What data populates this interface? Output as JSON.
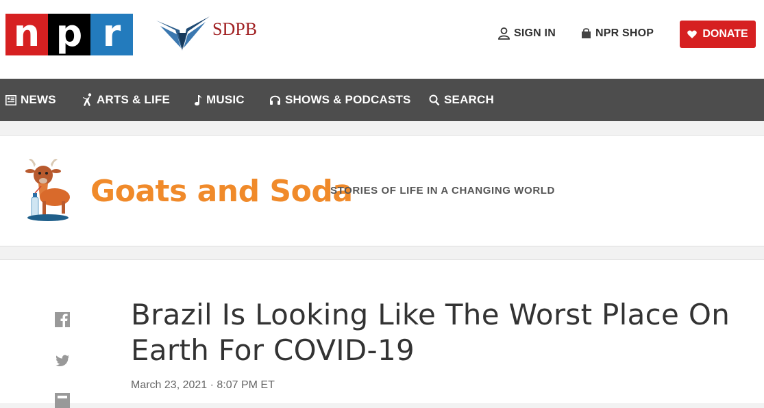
{
  "header": {
    "npr_logo_letters": [
      "n",
      "p",
      "r"
    ],
    "station_name": "SDPB",
    "sign_in_label": "SIGN IN",
    "shop_label": "NPR SHOP",
    "donate_label": "DONATE",
    "colors": {
      "npr_red": "#d62021",
      "npr_black": "#000000",
      "npr_blue": "#237bbd",
      "donate": "#d62021"
    }
  },
  "nav": {
    "items": [
      {
        "label": "NEWS",
        "icon": "news-icon"
      },
      {
        "label": "ARTS & LIFE",
        "icon": "arts-life-icon"
      },
      {
        "label": "MUSIC",
        "icon": "music-note-icon"
      },
      {
        "label": "SHOWS & PODCASTS",
        "icon": "headphones-icon"
      },
      {
        "label": "SEARCH",
        "icon": "search-icon"
      }
    ]
  },
  "section": {
    "title": "Goats and Soda",
    "subtitle": "STORIES OF LIFE IN A CHANGING WORLD",
    "title_color": "#f08a2a"
  },
  "article": {
    "headline": "Brazil Is Looking Like The Worst Place On Earth For COVID-19",
    "dateline": "March 23, 2021 · 8:07 PM ET",
    "share_icons": [
      "facebook-icon",
      "twitter-icon",
      "flipboard-icon"
    ]
  }
}
